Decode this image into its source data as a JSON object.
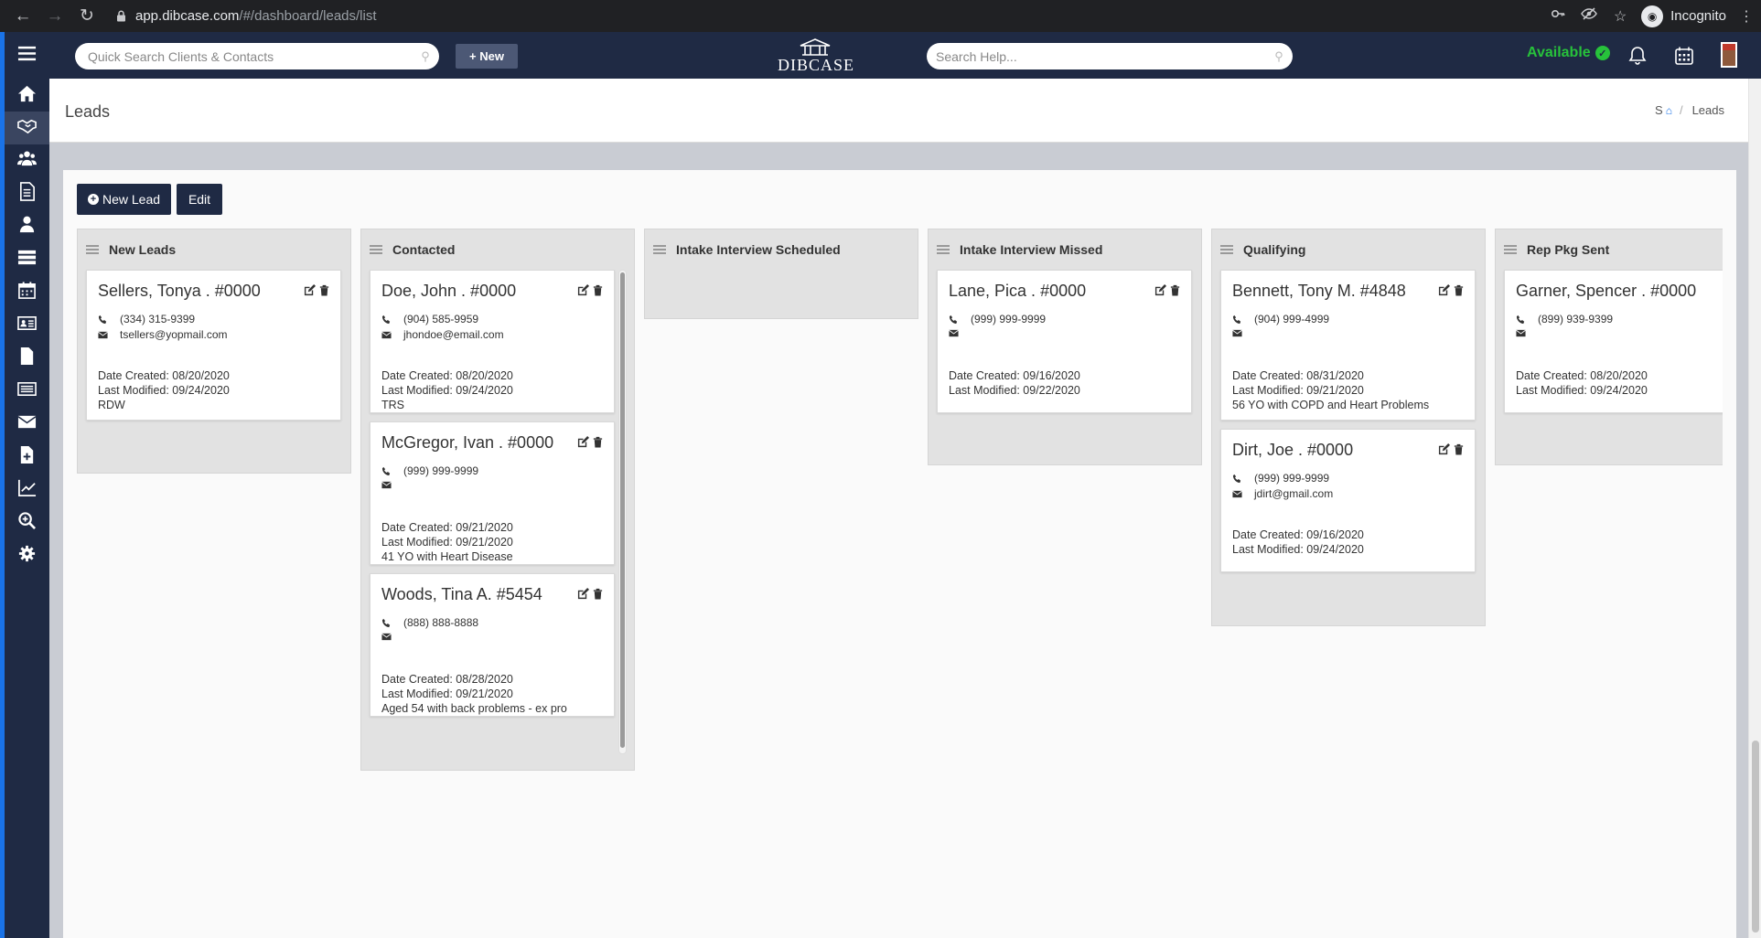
{
  "browser": {
    "url_host": "app.dibcase.com",
    "url_path": "/#/dashboard/leads/list",
    "profile_label": "Incognito"
  },
  "topbar": {
    "quick_search_placeholder": "Quick Search Clients & Contacts",
    "new_button": "+ New",
    "logo_text": "DIBCASE",
    "help_search_placeholder": "Search Help...",
    "status": "Available"
  },
  "sidebar": {
    "items": [
      {
        "icon": "home-icon"
      },
      {
        "icon": "handshake-icon",
        "active": true
      },
      {
        "icon": "users-icon"
      },
      {
        "icon": "document-icon"
      },
      {
        "icon": "user-icon"
      },
      {
        "icon": "list-icon"
      },
      {
        "icon": "calendar-icon"
      },
      {
        "icon": "id-card-icon"
      },
      {
        "icon": "file-icon"
      },
      {
        "icon": "newspaper-icon"
      },
      {
        "icon": "envelope-icon"
      },
      {
        "icon": "file-plus-icon"
      },
      {
        "icon": "line-chart-icon"
      },
      {
        "icon": "search-plus-icon"
      },
      {
        "icon": "gear-icon"
      }
    ]
  },
  "page": {
    "title": "Leads",
    "breadcrumb_root": "S",
    "breadcrumb_sep": "/",
    "breadcrumb_current": "Leads"
  },
  "actions": {
    "new_lead": "New Lead",
    "edit": "Edit"
  },
  "columns": [
    {
      "title": "New Leads",
      "cards": [
        {
          "name": "Sellers, Tonya . #0000",
          "phone": "(334) 315-9399",
          "email": "tsellers@yopmail.com",
          "created": "Date Created: 08/20/2020",
          "modified": "Last Modified: 09/24/2020",
          "note": "RDW"
        }
      ]
    },
    {
      "title": "Contacted",
      "cards": [
        {
          "name": "Doe, John . #0000",
          "phone": "(904) 585-9959",
          "email": "jhondoe@email.com",
          "created": "Date Created: 08/20/2020",
          "modified": "Last Modified: 09/24/2020",
          "note": "TRS"
        },
        {
          "name": "McGregor, Ivan . #0000",
          "phone": "(999) 999-9999",
          "email": "",
          "created": "Date Created: 09/21/2020",
          "modified": "Last Modified: 09/21/2020",
          "note": "41 YO with Heart Disease"
        },
        {
          "name": "Woods, Tina A. #5454",
          "phone": "(888) 888-8888",
          "email": "",
          "created": "Date Created: 08/28/2020",
          "modified": "Last Modified: 09/21/2020",
          "note": "Aged 54 with back problems - ex pro"
        }
      ]
    },
    {
      "title": "Intake Interview Scheduled",
      "cards": []
    },
    {
      "title": "Intake Interview Missed",
      "cards": [
        {
          "name": "Lane, Pica . #0000",
          "phone": "(999) 999-9999",
          "email": "",
          "created": "Date Created: 09/16/2020",
          "modified": "Last Modified: 09/22/2020",
          "note": ""
        }
      ]
    },
    {
      "title": "Qualifying",
      "cards": [
        {
          "name": "Bennett, Tony M. #4848",
          "phone": "(904) 999-4999",
          "email": "",
          "created": "Date Created: 08/31/2020",
          "modified": "Last Modified: 09/21/2020",
          "note": "56 YO with COPD and Heart Problems"
        },
        {
          "name": "Dirt, Joe . #0000",
          "phone": "(999) 999-9999",
          "email": "jdirt@gmail.com",
          "created": "Date Created: 09/16/2020",
          "modified": "Last Modified: 09/24/2020",
          "note": ""
        }
      ]
    },
    {
      "title": "Rep Pkg Sent",
      "cards": [
        {
          "name": "Garner, Spencer . #0000",
          "phone": "(899) 939-9399",
          "email": "",
          "created": "Date Created: 08/20/2020",
          "modified": "Last Modified: 09/24/2020",
          "note": ""
        }
      ]
    }
  ],
  "colors": {
    "navy": "#1f2a44",
    "available_green": "#27c23b",
    "link_blue": "#1a73e8"
  }
}
